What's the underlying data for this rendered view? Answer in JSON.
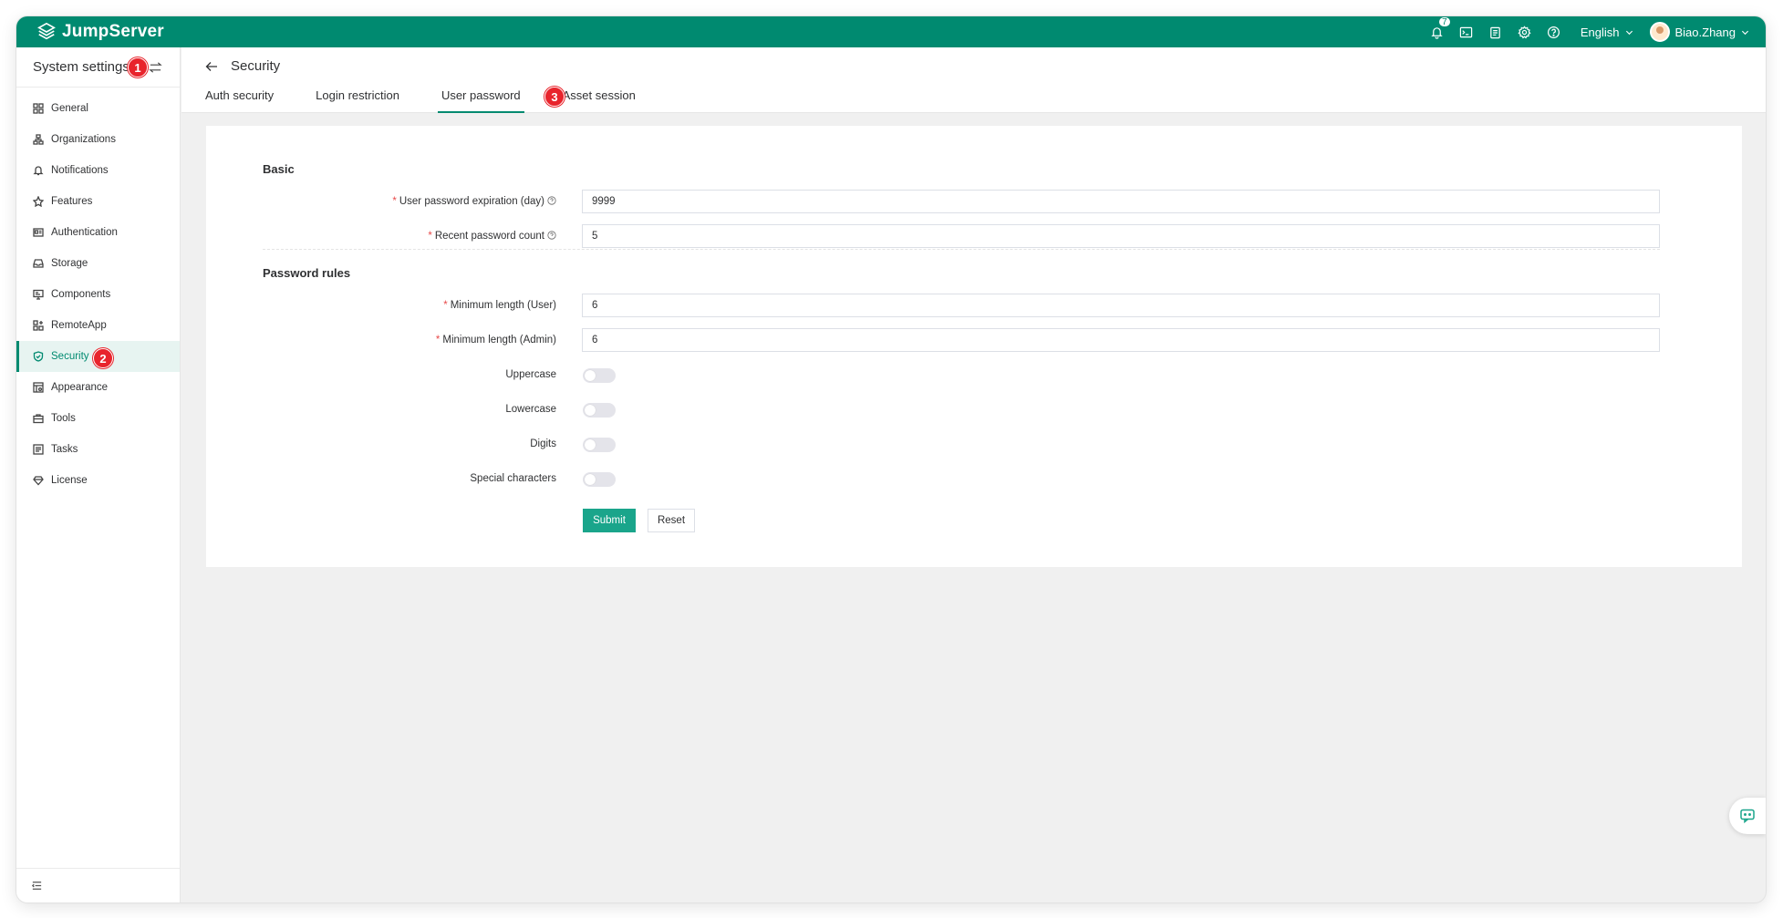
{
  "app": {
    "brand": "JumpServer",
    "notifications_count": "7",
    "language": "English",
    "user_name": "Biao.Zhang",
    "accent_color": "#008a70",
    "callout_color": "#e8242c"
  },
  "sidebar": {
    "title": "System settings",
    "items": [
      {
        "label": "General",
        "icon": "grid-icon"
      },
      {
        "label": "Organizations",
        "icon": "org-icon"
      },
      {
        "label": "Notifications",
        "icon": "bell-icon"
      },
      {
        "label": "Features",
        "icon": "feature-icon"
      },
      {
        "label": "Authentication",
        "icon": "id-card-icon"
      },
      {
        "label": "Storage",
        "icon": "storage-icon"
      },
      {
        "label": "Components",
        "icon": "monitor-icon"
      },
      {
        "label": "RemoteApp",
        "icon": "apps-icon"
      },
      {
        "label": "Security",
        "icon": "shield-icon"
      },
      {
        "label": "Appearance",
        "icon": "appearance-icon"
      },
      {
        "label": "Tools",
        "icon": "toolbox-icon"
      },
      {
        "label": "Tasks",
        "icon": "tasks-icon"
      },
      {
        "label": "License",
        "icon": "diamond-icon"
      }
    ],
    "active": "Security"
  },
  "callouts": [
    "1",
    "2",
    "3"
  ],
  "page": {
    "title": "Security",
    "tabs": [
      "Auth security",
      "Login restriction",
      "User password",
      "Asset session"
    ],
    "active_tab": "User password"
  },
  "form": {
    "basic_title": "Basic",
    "expiration_label": "User password expiration (day)",
    "expiration_value": "9999",
    "recent_count_label": "Recent password count",
    "recent_count_value": "5",
    "rules_title": "Password rules",
    "min_user_label": "Minimum length (User)",
    "min_user_value": "6",
    "min_admin_label": "Minimum length (Admin)",
    "min_admin_value": "6",
    "uppercase_label": "Uppercase",
    "uppercase_on": false,
    "lowercase_label": "Lowercase",
    "lowercase_on": false,
    "digits_label": "Digits",
    "digits_on": false,
    "special_label": "Special characters",
    "special_on": false,
    "required_mark": "*",
    "submit_label": "Submit",
    "reset_label": "Reset"
  }
}
